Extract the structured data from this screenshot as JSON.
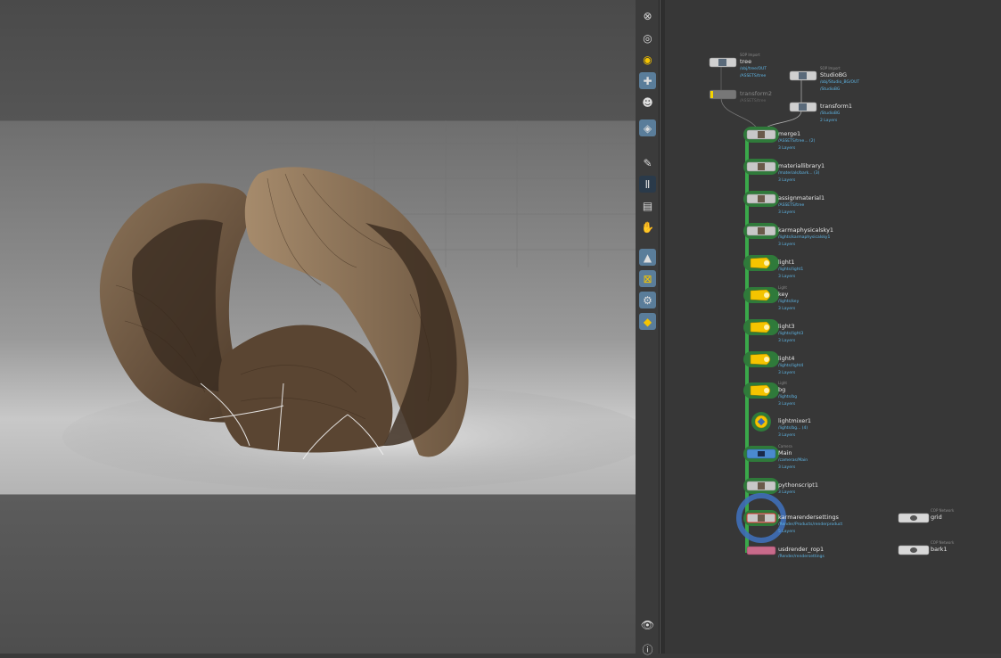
{
  "network": {
    "nodes": [
      {
        "name": "tree",
        "type": "SOP Import",
        "info": [
          "/obj/tree/OUT",
          "/ASSETS/tree"
        ]
      },
      {
        "name": "StudioBG",
        "type": "SOP Import",
        "info": [
          "/obj/Studio_BG/OUT",
          "/StudioBG"
        ]
      },
      {
        "name": "transform2",
        "type": "",
        "info": [
          "/ASSETS/tree"
        ]
      },
      {
        "name": "transform1",
        "type": "",
        "info": [
          "/StudioBG",
          "2 Layers"
        ]
      },
      {
        "name": "merge1",
        "type": "",
        "info": [
          "/ASSETS/tree... (2)",
          "3 Layers"
        ]
      },
      {
        "name": "materiallibrary1",
        "type": "",
        "info": [
          "/materials/bark... (3)",
          "3 Layers"
        ]
      },
      {
        "name": "assignmaterial1",
        "type": "",
        "info": [
          "/ASSETS/tree",
          "3 Layers"
        ]
      },
      {
        "name": "karmaphysicalsky1",
        "type": "",
        "info": [
          "/lights/karmaphysicalsky1",
          "3 Layers"
        ]
      },
      {
        "name": "light1",
        "type": "",
        "info": [
          "/lights/light1",
          "3 Layers"
        ]
      },
      {
        "name": "key",
        "type": "Light",
        "info": [
          "/lights/key",
          "3 Layers"
        ]
      },
      {
        "name": "light3",
        "type": "",
        "info": [
          "/lights/light3",
          "3 Layers"
        ]
      },
      {
        "name": "light4",
        "type": "",
        "info": [
          "/lights/light4",
          "3 Layers"
        ]
      },
      {
        "name": "bg",
        "type": "Light",
        "info": [
          "/lights/bg",
          "3 Layers"
        ]
      },
      {
        "name": "lightmixer1",
        "type": "",
        "info": [
          "/lights/bg... (4)",
          "3 Layers"
        ]
      },
      {
        "name": "Main",
        "type": "Camera",
        "info": [
          "/cameras/Main",
          "3 Layers"
        ]
      },
      {
        "name": "pythonscript1",
        "type": "",
        "info": [
          "3 Layers"
        ]
      },
      {
        "name": "karmarendersettings",
        "type": "",
        "info": [
          "/Render/Products/renderproduct",
          "5 Layers"
        ]
      },
      {
        "name": "usdrender_rop1",
        "type": "",
        "info": [
          "/Render/rendersettings"
        ]
      },
      {
        "name": "grid",
        "type": "COP Network",
        "info": []
      },
      {
        "name": "bark1",
        "type": "COP Network",
        "info": []
      }
    ]
  },
  "toolbar": {
    "tools": [
      "close-icon",
      "sphere-icon",
      "eye-ring-icon",
      "light-icon",
      "skull-icon",
      "camera-icon",
      "paint-icon",
      "pause-icon",
      "layers-icon",
      "hand-icon",
      "shapes-icon",
      "select-icon",
      "gear-icon",
      "diamond-icon",
      "eye-icon",
      "info-icon"
    ]
  },
  "colors": {
    "accent": "#5a7d9a",
    "light_node": "#f5c400",
    "wire": "#3aa84a",
    "path_text": "#5fb6e6"
  }
}
